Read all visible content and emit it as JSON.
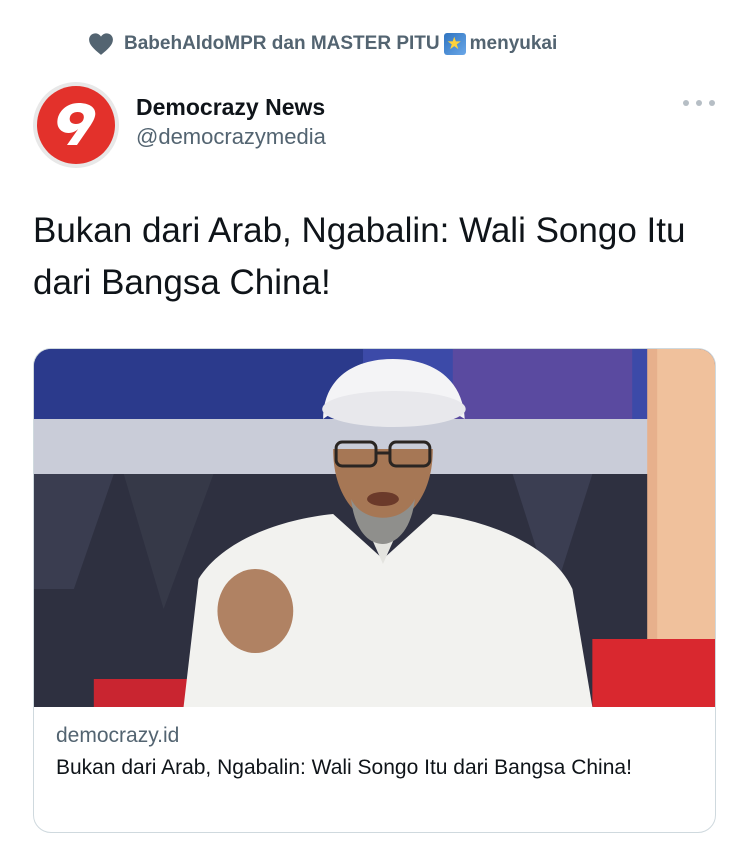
{
  "social_context": {
    "icon": "heart-icon",
    "likers_1": "BabehAldoMPR dan MASTER PITU",
    "emoji": "shooting-star-emoji",
    "verb": "menyukai"
  },
  "author": {
    "display_name": "Democrazy News",
    "handle": "@democrazymedia",
    "avatar_color": "#e3312b"
  },
  "tweet": {
    "text": "Bukan dari Arab, Ngabalin: Wali Songo Itu dari Bangsa China!"
  },
  "link_card": {
    "domain": "democrazy.id",
    "title": "Bukan dari Arab, Ngabalin: Wali Songo Itu dari Bangsa China!",
    "image": "photo of a man in white turban and white shirt speaking in a TV studio"
  },
  "colors": {
    "text_primary": "#0f1419",
    "text_secondary": "#536471",
    "border": "#cfd9de"
  }
}
